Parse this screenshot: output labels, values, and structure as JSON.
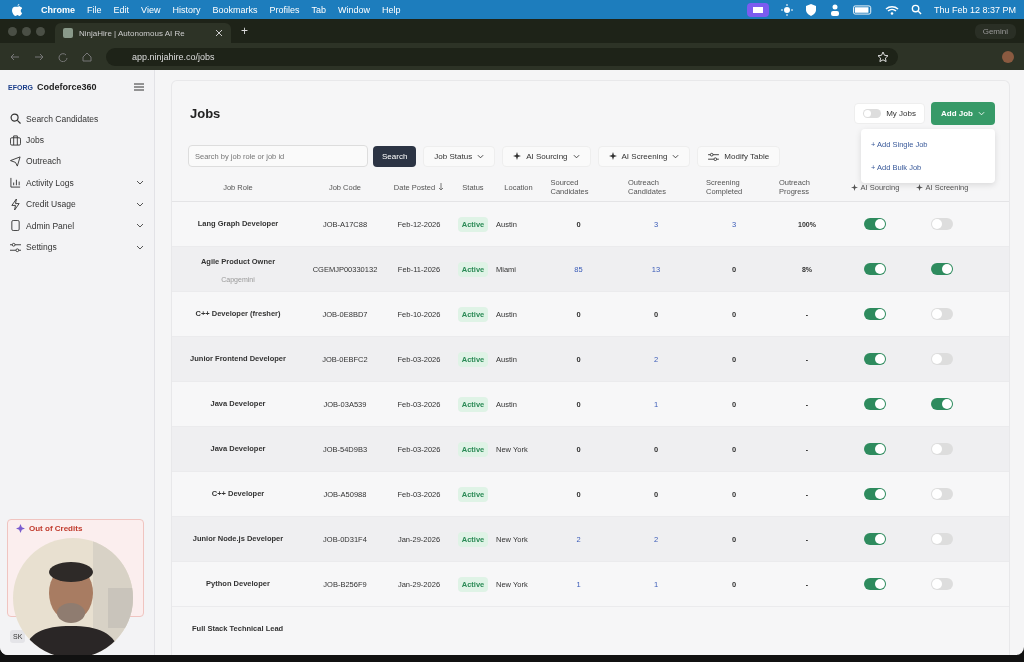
{
  "menu_bar": {
    "app": "Chrome",
    "items": [
      "File",
      "Edit",
      "View",
      "History",
      "Bookmarks",
      "Profiles",
      "Tab",
      "Window",
      "Help"
    ],
    "clock": "Thu Feb 12  8:37 PM"
  },
  "browser": {
    "tab_title": "NinjaHire | Autonomous AI Re",
    "new_tab": "+",
    "gemini": "Gemini",
    "url": "app.ninjahire.co/jobs"
  },
  "sidebar": {
    "logo": "EFORG",
    "brand": "Codeforce360",
    "items": [
      {
        "label": "Search Candidates",
        "expandable": false
      },
      {
        "label": "Jobs",
        "expandable": false
      },
      {
        "label": "Outreach",
        "expandable": false
      },
      {
        "label": "Activity Logs",
        "expandable": true
      },
      {
        "label": "Credit Usage",
        "expandable": true
      },
      {
        "label": "Admin Panel",
        "expandable": true
      },
      {
        "label": "Settings",
        "expandable": true
      }
    ],
    "credits_card": {
      "title": "Out of Credits"
    },
    "user": {
      "initials": "SK"
    }
  },
  "page": {
    "title": "Jobs",
    "my_jobs": {
      "label": "My Jobs",
      "on": false
    },
    "add_job": "Add Job",
    "add_job_menu": [
      "+ Add Single Job",
      "+ Add Bulk Job"
    ]
  },
  "toolbar": {
    "search": {
      "placeholder": "Search by job role or job id"
    },
    "search_button": "Search",
    "filters": [
      "Job Status",
      "AI Sourcing",
      "AI Screening"
    ],
    "modify": "Modify Table"
  },
  "table": {
    "columns": [
      "Job Role",
      "Job Code",
      "Date Posted",
      "Status",
      "Location",
      "Sourced Candidates",
      "Outreach Candidates",
      "Screening Completed",
      "Outreach Progress",
      "AI Sourcing",
      "AI Screening"
    ],
    "rows": [
      {
        "role": "Lang Graph Developer",
        "code": "JOB-A17C88",
        "date": "Feb-12-2026",
        "status": "Active",
        "location": "Austin",
        "sourced": {
          "text": "0",
          "link": false
        },
        "outreach": {
          "text": "3",
          "link": true
        },
        "screening": {
          "text": "3",
          "link": true
        },
        "progress": "100%",
        "ai_sourcing": true,
        "ai_screening": false
      },
      {
        "role": "Agile Product Owner",
        "company": "Capgemini",
        "code": "CGEMJP00330132",
        "date": "Feb-11-2026",
        "status": "Active",
        "location": "Miami",
        "sourced": {
          "text": "85",
          "link": true
        },
        "outreach": {
          "text": "13",
          "link": true
        },
        "screening": {
          "text": "0",
          "link": false
        },
        "progress": "8%",
        "ai_sourcing": true,
        "ai_screening": true
      },
      {
        "role": "C++ Developer (fresher)",
        "code": "JOB-0E8BD7",
        "date": "Feb-10-2026",
        "status": "Active",
        "location": "Austin",
        "sourced": {
          "text": "0",
          "link": false
        },
        "outreach": {
          "text": "0",
          "link": false
        },
        "screening": {
          "text": "0",
          "link": false
        },
        "progress": "-",
        "ai_sourcing": true,
        "ai_screening": false
      },
      {
        "role": "Junior Frontend Developer",
        "code": "JOB-0EBFC2",
        "date": "Feb-03-2026",
        "status": "Active",
        "location": "Austin",
        "sourced": {
          "text": "0",
          "link": false
        },
        "outreach": {
          "text": "2",
          "link": true
        },
        "screening": {
          "text": "0",
          "link": false
        },
        "progress": "-",
        "ai_sourcing": true,
        "ai_screening": false
      },
      {
        "role": "Java Developer",
        "code": "JOB-03A539",
        "date": "Feb-03-2026",
        "status": "Active",
        "location": "Austin",
        "sourced": {
          "text": "0",
          "link": false
        },
        "outreach": {
          "text": "1",
          "link": true
        },
        "screening": {
          "text": "0",
          "link": false
        },
        "progress": "-",
        "ai_sourcing": true,
        "ai_screening": true
      },
      {
        "role": "Java Developer",
        "code": "JOB-54D9B3",
        "date": "Feb-03-2026",
        "status": "Active",
        "location": "New York",
        "sourced": {
          "text": "0",
          "link": false
        },
        "outreach": {
          "text": "0",
          "link": false
        },
        "screening": {
          "text": "0",
          "link": false
        },
        "progress": "-",
        "ai_sourcing": true,
        "ai_screening": false
      },
      {
        "role": "C++ Developer",
        "code": "JOB-A50988",
        "date": "Feb-03-2026",
        "status": "Active",
        "sourced": {
          "text": "0",
          "link": false
        },
        "outreach": {
          "text": "0",
          "link": false
        },
        "screening": {
          "text": "0",
          "link": false
        },
        "progress": "-",
        "ai_sourcing": true,
        "ai_screening": false
      },
      {
        "role": "Junior Node.js Developer",
        "code": "JOB-0D31F4",
        "date": "Jan-29-2026",
        "status": "Active",
        "location": "New York",
        "sourced": {
          "text": "2",
          "link": true
        },
        "outreach": {
          "text": "2",
          "link": true
        },
        "screening": {
          "text": "0",
          "link": false
        },
        "progress": "-",
        "ai_sourcing": true,
        "ai_screening": false
      },
      {
        "role": "Python Developer",
        "code": "JOB-B256F9",
        "date": "Jan-29-2026",
        "status": "Active",
        "location": "New York",
        "sourced": {
          "text": "1",
          "link": true
        },
        "outreach": {
          "text": "1",
          "link": true
        },
        "screening": {
          "text": "0",
          "link": false
        },
        "progress": "-",
        "ai_sourcing": true,
        "ai_screening": false
      }
    ],
    "partial_row": "Full Stack Technical Lead"
  }
}
